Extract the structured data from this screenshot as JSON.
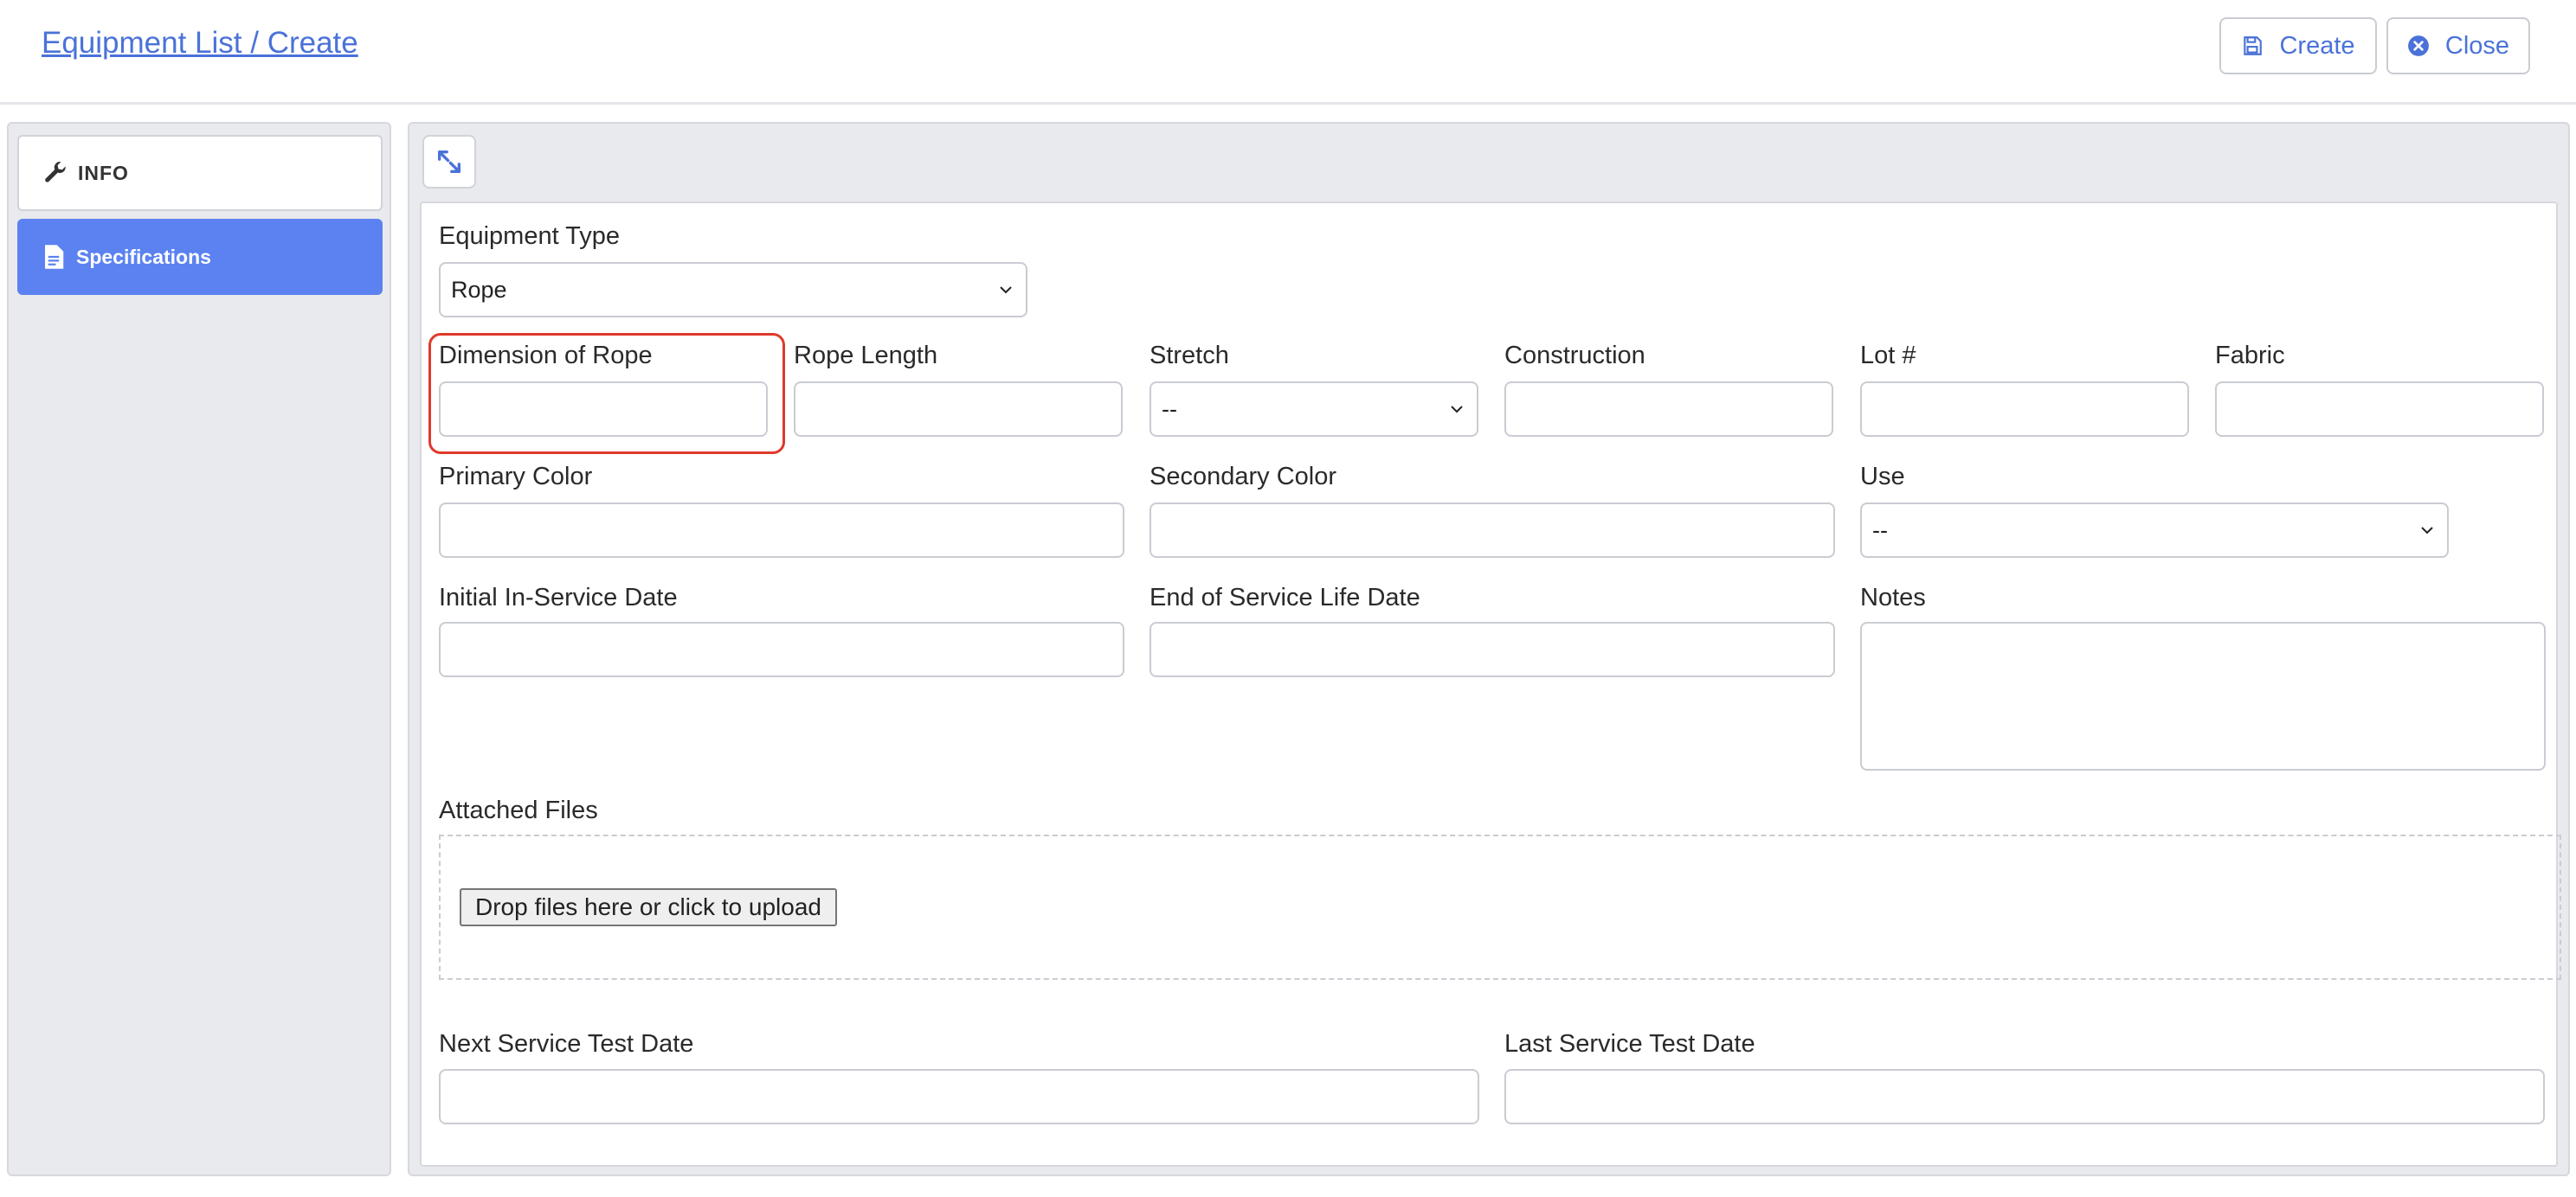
{
  "header": {
    "breadcrumb": "Equipment List / Create",
    "create_label": "Create",
    "close_label": "Close",
    "accent": "#4a72d8"
  },
  "sidebar": {
    "items": [
      {
        "label": "INFO",
        "icon": "wrench-icon",
        "active": false
      },
      {
        "label": "Specifications",
        "icon": "document-icon",
        "active": true
      }
    ],
    "active_color": "#5b82f0"
  },
  "form": {
    "equipment_type": {
      "label": "Equipment Type",
      "value": "Rope"
    },
    "dimension_of_rope": {
      "label": "Dimension of Rope",
      "value": ""
    },
    "rope_length": {
      "label": "Rope Length",
      "value": ""
    },
    "stretch": {
      "label": "Stretch",
      "value": "--"
    },
    "construction": {
      "label": "Construction",
      "value": ""
    },
    "lot": {
      "label": "Lot #",
      "value": ""
    },
    "fabric": {
      "label": "Fabric",
      "value": ""
    },
    "primary_color": {
      "label": "Primary Color",
      "value": ""
    },
    "secondary_color": {
      "label": "Secondary Color",
      "value": ""
    },
    "use": {
      "label": "Use",
      "value": "--"
    },
    "initial_in_service_date": {
      "label": "Initial In-Service Date",
      "value": ""
    },
    "end_of_service_life_date": {
      "label": "End of Service Life Date",
      "value": ""
    },
    "notes": {
      "label": "Notes",
      "value": ""
    },
    "attached_files": {
      "label": "Attached Files",
      "upload_label": "Drop files here or click to upload"
    },
    "next_service_test_date": {
      "label": "Next Service Test Date",
      "value": ""
    },
    "last_service_test_date": {
      "label": "Last Service Test Date",
      "value": ""
    }
  },
  "highlight_color": "#e0392b"
}
